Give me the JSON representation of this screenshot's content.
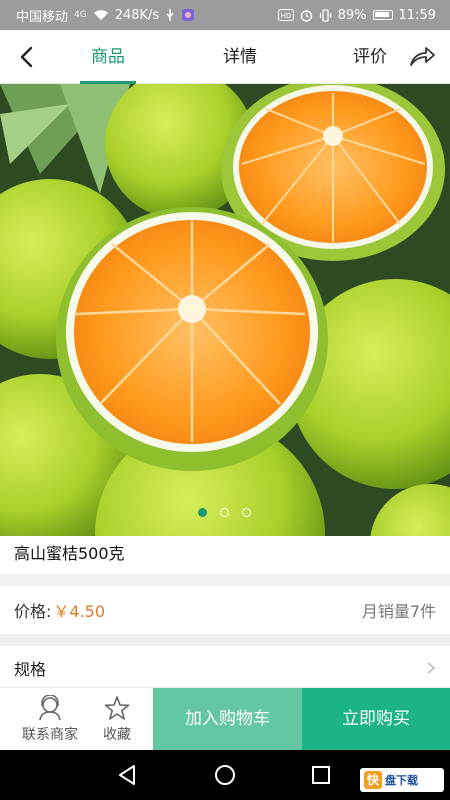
{
  "status_bar": {
    "carrier": "中国移动",
    "signal_label": "4G",
    "speed": "248K/s",
    "battery": "89%",
    "time": "11:59"
  },
  "nav": {
    "tabs": [
      {
        "label": "商品",
        "active": true
      },
      {
        "label": "详情",
        "active": false
      },
      {
        "label": "评价",
        "active": false
      }
    ]
  },
  "carousel": {
    "dots": 3,
    "active_index": 0
  },
  "product": {
    "title": "高山蜜桔500克",
    "price_label": "价格:",
    "price": "￥4.50",
    "monthly_sales": "月销量7件",
    "spec_label": "规格"
  },
  "actions": {
    "contact_label": "联系商家",
    "favorite_label": "收藏",
    "add_to_cart_label": "加入购物车",
    "buy_now_label": "立即购买"
  },
  "watermark": {
    "badge": "快",
    "text": "盘下载"
  },
  "colors": {
    "accent": "#1c9a74",
    "cart_button": "#63c7a2",
    "buy_button": "#1cb386",
    "price": "#e07b22"
  }
}
